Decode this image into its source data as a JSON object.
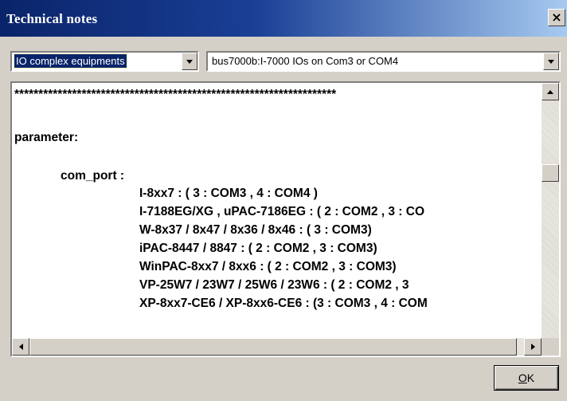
{
  "window": {
    "title": "Technical notes",
    "close_glyph": "×"
  },
  "category_select": {
    "value": "IO complex equipments"
  },
  "item_select": {
    "value": "bus7000b:I-7000 IOs on Com3 or COM4"
  },
  "notes": {
    "lines": [
      "*******************************************************************",
      "",
      "parameter:",
      "",
      "com_port   :",
      "I-8xx7 :  ( 3 : COM3 ,  4 : COM4 )",
      "I-7188EG/XG , uPAC-7186EG :  ( 2 : COM2 ,  3 : CO",
      "W-8x37 / 8x47 / 8x36 / 8x46 :  ( 3 : COM3)",
      "iPAC-8447 / 8847 :  ( 2 : COM2 ,  3 : COM3)",
      "WinPAC-8xx7 / 8xx6 :  ( 2 : COM2 ,  3 : COM3)",
      "VP-25W7 / 23W7 / 25W6 / 23W6  :  ( 2 : COM2  , 3",
      "XP-8xx7-CE6 / XP-8xx6-CE6 :  (3 : COM3  ,  4 : COM"
    ]
  },
  "ok_button": {
    "prefix": "",
    "accel": "O",
    "rest": "K"
  },
  "colors": {
    "title_gradient_start": "#0a246a",
    "title_gradient_end": "#a6caf0",
    "dialog_face": "#d4d0c8",
    "selection": "#0a246a"
  }
}
